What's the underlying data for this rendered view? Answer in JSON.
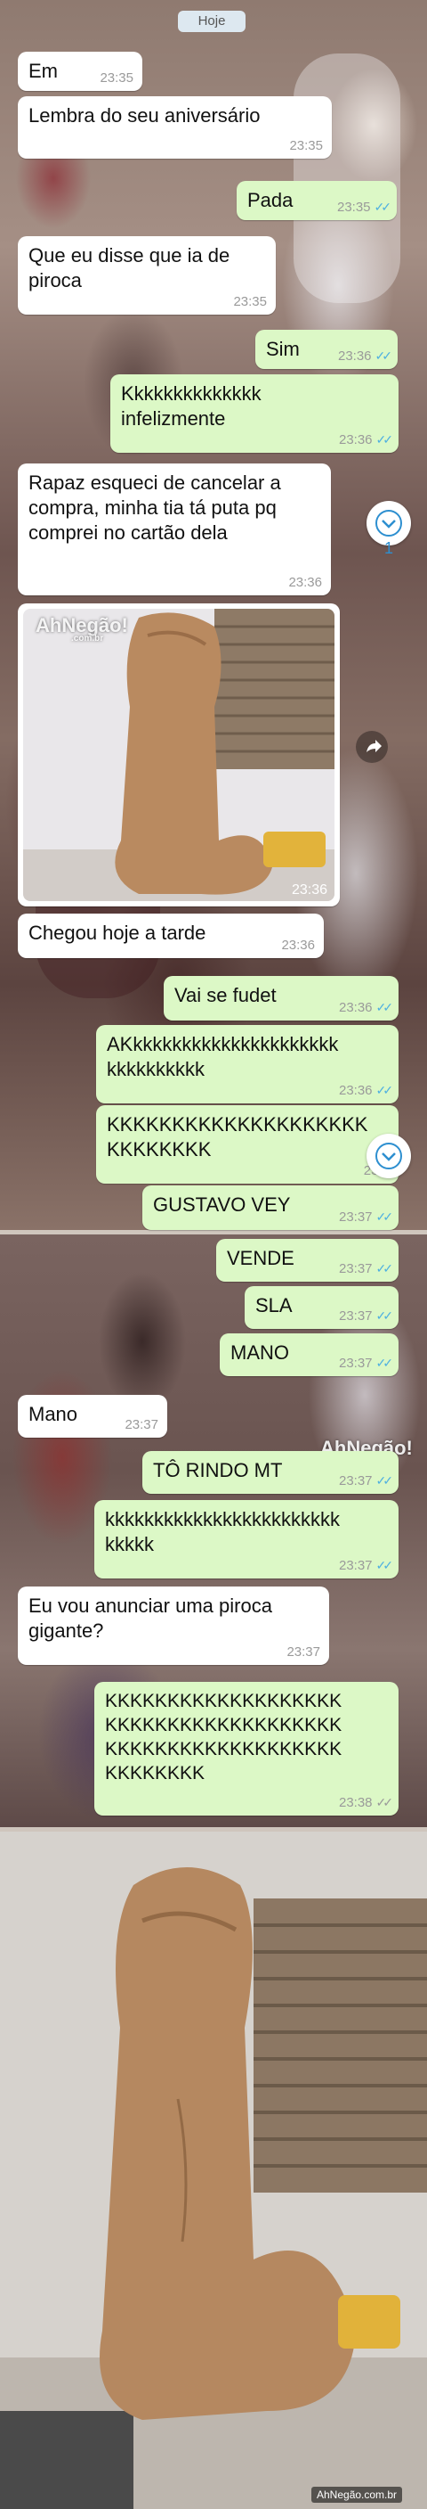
{
  "chat": {
    "date_chip": "Hoje",
    "messages": [
      {
        "dir": "in",
        "text": "Em",
        "time": "23:35"
      },
      {
        "dir": "in",
        "text": "Lembra do seu aniversário",
        "time": "23:35"
      },
      {
        "dir": "out",
        "text": "Pada",
        "time": "23:35"
      },
      {
        "dir": "in",
        "text": "Que eu disse que ia de\npiroca",
        "time": "23:35"
      },
      {
        "dir": "out",
        "text": "Sim",
        "time": "23:36"
      },
      {
        "dir": "out",
        "text": "Kkkkkkkkkkkkkk\ninfelizmente",
        "time": "23:36"
      },
      {
        "dir": "in",
        "text": "Rapaz esqueci de cancelar a\ncompra, minha tia tá puta pq\ncomprei no cartão dela",
        "time": "23:36"
      },
      {
        "dir": "in",
        "type": "photo",
        "time": "23:36"
      },
      {
        "dir": "in",
        "text": "Chegou hoje a tarde",
        "time": "23:36"
      },
      {
        "dir": "out",
        "text": "Vai se fudet",
        "time": "23:36"
      },
      {
        "dir": "out",
        "text": "AKkkkkkkkkkkkkkkkkkkkkk\nkkkkkkkkkk",
        "time": "23:36"
      },
      {
        "dir": "out",
        "text": "KKKKKKKKKKKKKKKKKKKK\nKKKKKKKK",
        "time": "23:3"
      },
      {
        "dir": "out",
        "text": "GUSTAVO VEY",
        "time": "23:37"
      },
      {
        "dir": "out",
        "text": "VENDE",
        "time": "23:37"
      },
      {
        "dir": "out",
        "text": "SLA",
        "time": "23:37"
      },
      {
        "dir": "out",
        "text": "MANO",
        "time": "23:37"
      },
      {
        "dir": "in",
        "text": "Mano",
        "time": "23:37"
      },
      {
        "dir": "out",
        "text": "TÔ RINDO MT",
        "time": "23:37"
      },
      {
        "dir": "out",
        "text": "kkkkkkkkkkkkkkkkkkkkkkkk\nkkkkk",
        "time": "23:37"
      },
      {
        "dir": "in",
        "text": "Eu vou anunciar uma piroca\ngigante?",
        "time": "23:37"
      },
      {
        "dir": "out",
        "text": "KKKKKKKKKKKKKKKKKKK\nKKKKKKKKKKKKKKKKKKK\nKKKKKKKKKKKKKKKKKKK\nKKKKKKKK",
        "time": "23:38"
      }
    ],
    "unread_badge": "1"
  },
  "watermark": {
    "brand": "AhNegão!",
    "domain": ".com.br",
    "footer": "AhNegão.com.br"
  },
  "icons": {
    "scroll_down": "chevron-down-icon",
    "forward": "forward-icon",
    "ticks": "double-check-icon"
  },
  "colors": {
    "incoming": "#ffffff",
    "outgoing": "#dcf8c6",
    "tick_blue": "#4fb0e0"
  }
}
